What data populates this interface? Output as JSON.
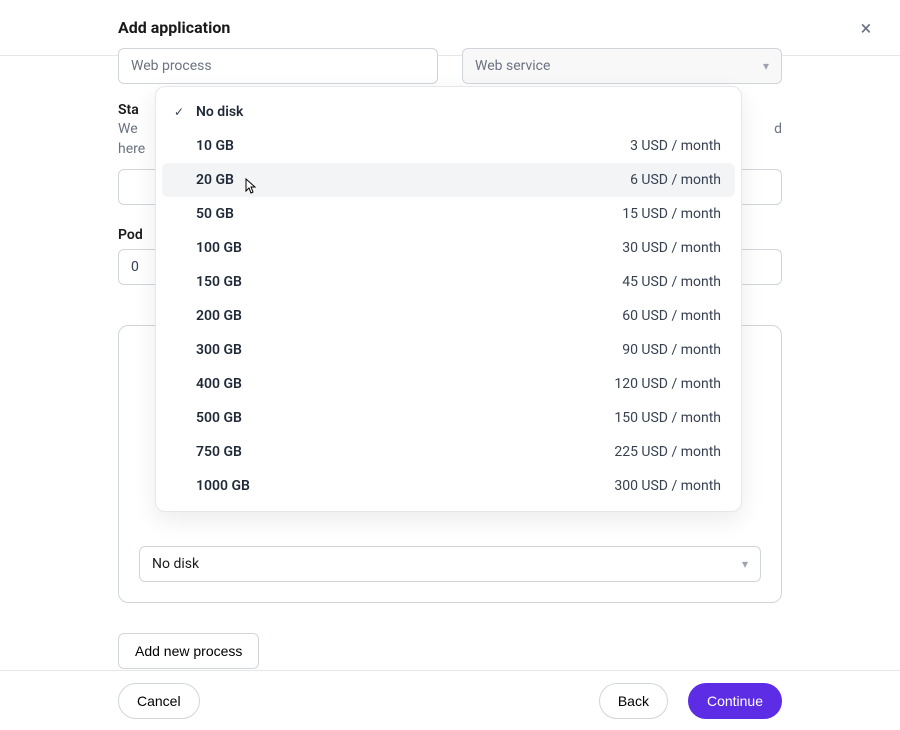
{
  "header": {
    "title": "Add application",
    "close_icon": "×"
  },
  "process": {
    "input_value": "Web process",
    "service_value": "Web service"
  },
  "start": {
    "title_visible": "Sta",
    "hint_line1": "We",
    "hint_line2": "here"
  },
  "pod": {
    "label_visible": "Pod",
    "value": "0"
  },
  "disk_select": {
    "value": "No disk"
  },
  "disk_options": [
    {
      "size": "No disk",
      "price": ""
    },
    {
      "size": "10 GB",
      "price": "3 USD / month"
    },
    {
      "size": "20 GB",
      "price": "6 USD / month"
    },
    {
      "size": "50 GB",
      "price": "15 USD / month"
    },
    {
      "size": "100 GB",
      "price": "30 USD / month"
    },
    {
      "size": "150 GB",
      "price": "45 USD / month"
    },
    {
      "size": "200 GB",
      "price": "60 USD / month"
    },
    {
      "size": "300 GB",
      "price": "90 USD / month"
    },
    {
      "size": "400 GB",
      "price": "120 USD / month"
    },
    {
      "size": "500 GB",
      "price": "150 USD / month"
    },
    {
      "size": "750 GB",
      "price": "225 USD / month"
    },
    {
      "size": "1000 GB",
      "price": "300 USD / month"
    }
  ],
  "dropdown_state": {
    "selected_index": 0,
    "hovered_index": 2
  },
  "phantom_box_right": "d",
  "buttons": {
    "add_process": "Add new process",
    "cancel": "Cancel",
    "back": "Back",
    "continue": "Continue"
  }
}
